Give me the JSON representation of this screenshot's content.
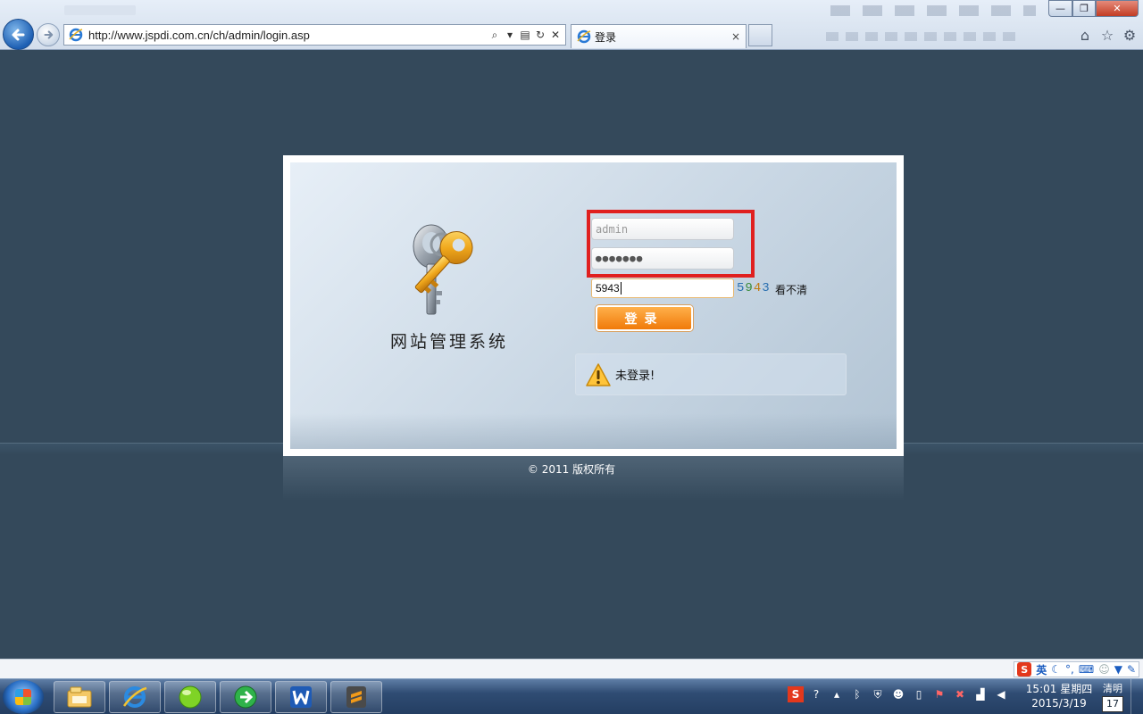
{
  "browser": {
    "url": "http://www.jspdi.com.cn/ch/admin/login.asp",
    "tab_title": "登录",
    "tab_close": "×",
    "window_controls": {
      "minimize": "—",
      "maximize": "❐",
      "close": "✕"
    }
  },
  "login": {
    "system_title": "网站管理系统",
    "username_value": "admin",
    "password_value": "●●●●●●●",
    "captcha_input_value": "5943",
    "captcha_digits": [
      "5",
      "9",
      "4",
      "3"
    ],
    "captcha_refresh_label": "看不清",
    "submit_label": "登录",
    "status_icon": "warning-icon",
    "status_text": "未登录!",
    "highlight_color": "#e0201f"
  },
  "footer": {
    "copyright": "© 2011 版权所有"
  },
  "ime_bar": {
    "logo": "S",
    "lang": "英",
    "icons": [
      "moon-icon",
      "punctuation-icon",
      "keyboard-icon",
      "user-icon",
      "shirt-icon",
      "wrench-icon"
    ]
  },
  "taskbar": {
    "apps": [
      "file-explorer-icon",
      "internet-explorer-icon",
      "green-ball-app-icon",
      "green-circle-app-icon",
      "wps-writer-icon",
      "sublime-text-icon"
    ],
    "tray_icons": [
      "sogou-ime-icon",
      "help-icon",
      "overflow-icon",
      "bluetooth-icon",
      "security-icon",
      "user-icon",
      "display-icon",
      "flag-icon",
      "alert-icon",
      "network-icon",
      "volume-icon"
    ],
    "time": "15:01 星期四",
    "date": "2015/3/19",
    "weather_label": "清明",
    "weather_day": "17"
  },
  "colors": {
    "page_background": "#34495b",
    "login_button": "#f07a0a",
    "highlight": "#e0201f"
  }
}
